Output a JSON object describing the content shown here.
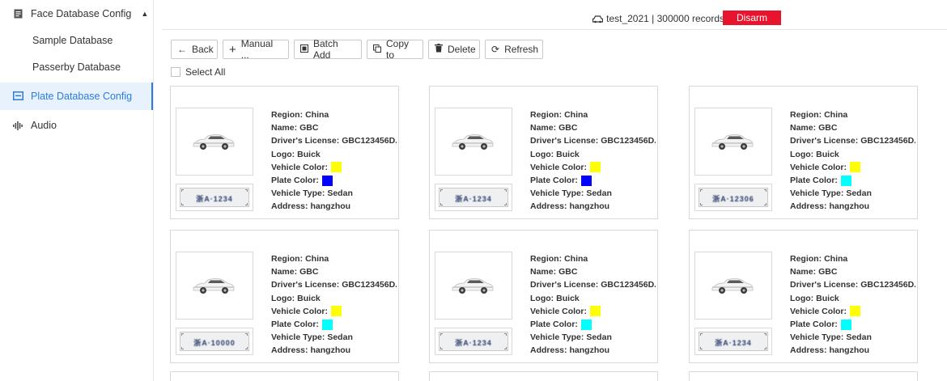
{
  "sidebar": {
    "face_db_group": "Face Database Config",
    "items": [
      {
        "label": "Sample Database"
      },
      {
        "label": "Passerby Database"
      }
    ],
    "plate_db": "Plate Database Config",
    "audio": "Audio"
  },
  "topbar": {
    "db_info": "test_2021 | 300000 records",
    "disarm_label": "Disarm",
    "disarm_color": "#e8142e"
  },
  "toolbar": {
    "back": "Back",
    "manual": "Manual ...",
    "batch_add": "Batch Add",
    "copy_to": "Copy to",
    "delete": "Delete",
    "refresh": "Refresh"
  },
  "select_all": "Select All",
  "labels": {
    "region": "Region:",
    "name": "Name:",
    "license": "Driver's License:",
    "logo": "Logo:",
    "vehicle_color": "Vehicle Color:",
    "plate_color": "Plate Color:",
    "vehicle_type": "Vehicle Type:",
    "address": "Address:"
  },
  "cards": [
    {
      "region": "China",
      "name": "GBC",
      "license": "GBC123456D...",
      "logo": "Buick",
      "vehicle_color": "#ffff00",
      "plate_color": "#0000ff",
      "vehicle_type": "Sedan",
      "address": "hangzhou",
      "plate": "浙A·1234"
    },
    {
      "region": "China",
      "name": "GBC",
      "license": "GBC123456D...",
      "logo": "Buick",
      "vehicle_color": "#ffff00",
      "plate_color": "#0000ff",
      "vehicle_type": "Sedan",
      "address": "hangzhou",
      "plate": "浙A·1234"
    },
    {
      "region": "China",
      "name": "GBC",
      "license": "GBC123456D...",
      "logo": "Buick",
      "vehicle_color": "#ffff00",
      "plate_color": "#00ffff",
      "vehicle_type": "Sedan",
      "address": "hangzhou",
      "plate": "浙A·12306"
    },
    {
      "region": "China",
      "name": "GBC",
      "license": "GBC123456D...",
      "logo": "Buick",
      "vehicle_color": "#ffff00",
      "plate_color": "#00ffff",
      "vehicle_type": "Sedan",
      "address": "hangzhou",
      "plate": "浙A·10000"
    },
    {
      "region": "China",
      "name": "GBC",
      "license": "GBC123456D...",
      "logo": "Buick",
      "vehicle_color": "#ffff00",
      "plate_color": "#00ffff",
      "vehicle_type": "Sedan",
      "address": "hangzhou",
      "plate": "浙A·1234"
    },
    {
      "region": "China",
      "name": "GBC",
      "license": "GBC123456D...",
      "logo": "Buick",
      "vehicle_color": "#ffff00",
      "plate_color": "#00ffff",
      "vehicle_type": "Sedan",
      "address": "hangzhou",
      "plate": "浙A·1234"
    }
  ]
}
